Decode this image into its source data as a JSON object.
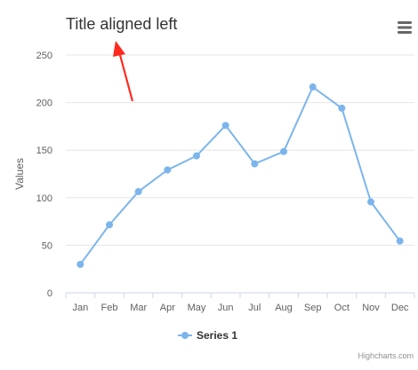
{
  "colors": {
    "series": "#7cb5ec",
    "arrow": "#ff2a1f",
    "grid": "#e6e6e6",
    "axis_line": "#ccd6eb",
    "text": "#333333",
    "muted": "#606060",
    "menu_icon": "#666666"
  },
  "menu": {
    "icon": "hamburger-menu-icon"
  },
  "credits": "Highcharts.com",
  "annotation": {
    "type": "arrow",
    "points_to": "title"
  },
  "chart_data": {
    "type": "line",
    "title": "Title aligned left",
    "title_align": "left",
    "categories": [
      "Jan",
      "Feb",
      "Mar",
      "Apr",
      "May",
      "Jun",
      "Jul",
      "Aug",
      "Sep",
      "Oct",
      "Nov",
      "Dec"
    ],
    "series": [
      {
        "name": "Series 1",
        "values": [
          29.9,
          71.5,
          106.4,
          129.2,
          144.0,
          176.0,
          135.6,
          148.5,
          216.4,
          194.1,
          95.6,
          54.4
        ]
      }
    ],
    "ylabel": "Values",
    "xlabel": "",
    "ylim": [
      0,
      250
    ],
    "yticks": [
      "0",
      "50",
      "100",
      "150",
      "200",
      "250"
    ],
    "grid": true,
    "legend": "bottom-center",
    "markers": true
  }
}
